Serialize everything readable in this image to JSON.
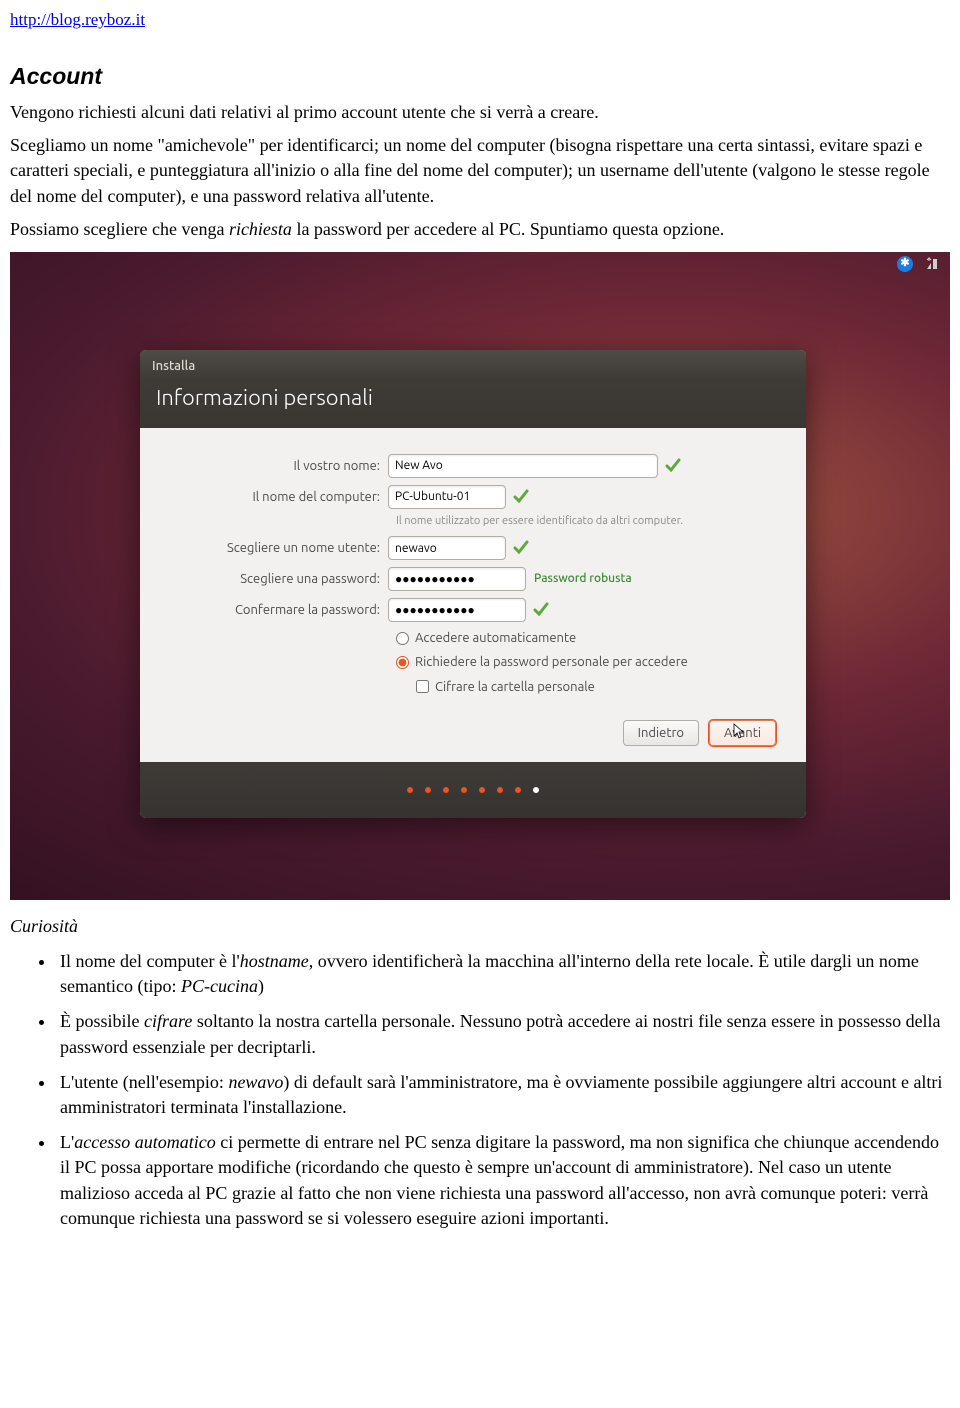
{
  "url": "http://blog.reyboz.it",
  "heading": "Account",
  "intro": "Vengono richiesti alcuni dati relativi al primo account utente che si verrà a creare.",
  "p1_a": "Scegliamo un nome \"amichevole\" per identificarci; un nome del computer (bisogna rispettare una certa sintassi, evitare spazi e caratteri speciali, e punteggiatura all'inizio o alla fine del nome del computer); un username dell'utente (valgono le stesse regole del nome del computer), e una password relativa all'utente.",
  "p2_a": "Possiamo scegliere che venga ",
  "p2_italic": "richiesta",
  "p2_b": " la password per accedere al PC. Spuntiamo questa opzione.",
  "installer": {
    "title": "Installa",
    "header": "Informazioni personali",
    "labels": {
      "name": "Il vostro nome:",
      "computer": "Il nome del computer:",
      "helper": "Il nome utilizzato per essere identificato da altri computer.",
      "username": "Scegliere un nome utente:",
      "password": "Scegliere una password:",
      "confirm": "Confermare la password:"
    },
    "values": {
      "name": "New Avo",
      "computer": "PC-Ubuntu-01",
      "username": "newavo",
      "password": "●●●●●●●●●●●",
      "confirm": "●●●●●●●●●●●"
    },
    "strength": "Password robusta",
    "options": {
      "auto": "Accedere automaticamente",
      "require": "Richiedere la password personale per accedere",
      "encrypt": "Cifrare la cartella personale"
    },
    "buttons": {
      "back": "Indietro",
      "next": "Avanti"
    }
  },
  "curiosita_heading": "Curiosità",
  "curio": {
    "c1_a": "Il nome del computer è l'",
    "c1_i1": "hostname",
    "c1_b": ", ovvero identificherà la macchina all'interno della rete locale. È utile dargli un nome semantico (tipo: ",
    "c1_i2": "PC-cucina",
    "c1_c": ")",
    "c2_a": "È possibile ",
    "c2_i": "cifrare",
    "c2_b": " soltanto la nostra cartella personale. Nessuno potrà accedere ai nostri file senza essere in possesso della password essenziale per decriptarli.",
    "c3_a": "L'utente (nell'esempio: ",
    "c3_i": "newavo",
    "c3_b": ") di default sarà l'amministratore, ma è ovviamente possibile aggiungere altri account e altri amministratori terminata l'installazione.",
    "c4_a": "L'",
    "c4_i": "accesso automatico",
    "c4_b": " ci permette di entrare nel PC senza digitare la password, ma non significa che chiunque accendendo il PC possa apportare modifiche (ricordando che questo è sempre un'account di amministratore). Nel caso un utente malizioso acceda al PC grazie al fatto che non viene richiesta una password all'accesso, non avrà comunque poteri: verrà comunque richiesta una password se si volessero eseguire azioni importanti."
  }
}
